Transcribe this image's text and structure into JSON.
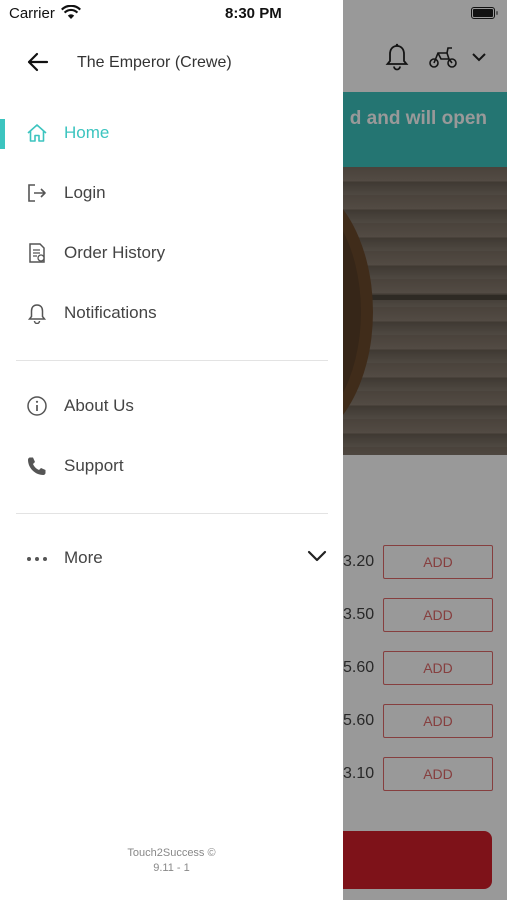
{
  "status_bar": {
    "carrier": "Carrier",
    "time": "8:30 PM"
  },
  "drawer": {
    "title": "The Emperor (Crewe)",
    "nav_items": [
      {
        "label": "Home",
        "icon": "home-icon",
        "active": true
      },
      {
        "label": "Login",
        "icon": "login-icon"
      },
      {
        "label": "Order History",
        "icon": "order-history-icon"
      },
      {
        "label": "Notifications",
        "icon": "bell-icon"
      }
    ],
    "secondary_items": [
      {
        "label": "About Us",
        "icon": "info-icon"
      },
      {
        "label": "Support",
        "icon": "phone-icon"
      }
    ],
    "more": {
      "label": "More",
      "icon": "more-dots-icon"
    },
    "footer": {
      "line1": "Touch2Success ©",
      "line2": "9.11 - 1"
    }
  },
  "background": {
    "banner_text": "d and will open",
    "menu_rows": [
      {
        "price": "3.20",
        "button": "ADD"
      },
      {
        "price": "3.50",
        "button": "ADD"
      },
      {
        "price": "5.60",
        "button": "ADD"
      },
      {
        "price": "5.60",
        "button": "ADD"
      },
      {
        "price": "3.10",
        "button": "ADD"
      }
    ]
  },
  "colors": {
    "accent": "#3cc4bf",
    "cart": "#d21f2a",
    "add_border": "#e06a6a"
  }
}
